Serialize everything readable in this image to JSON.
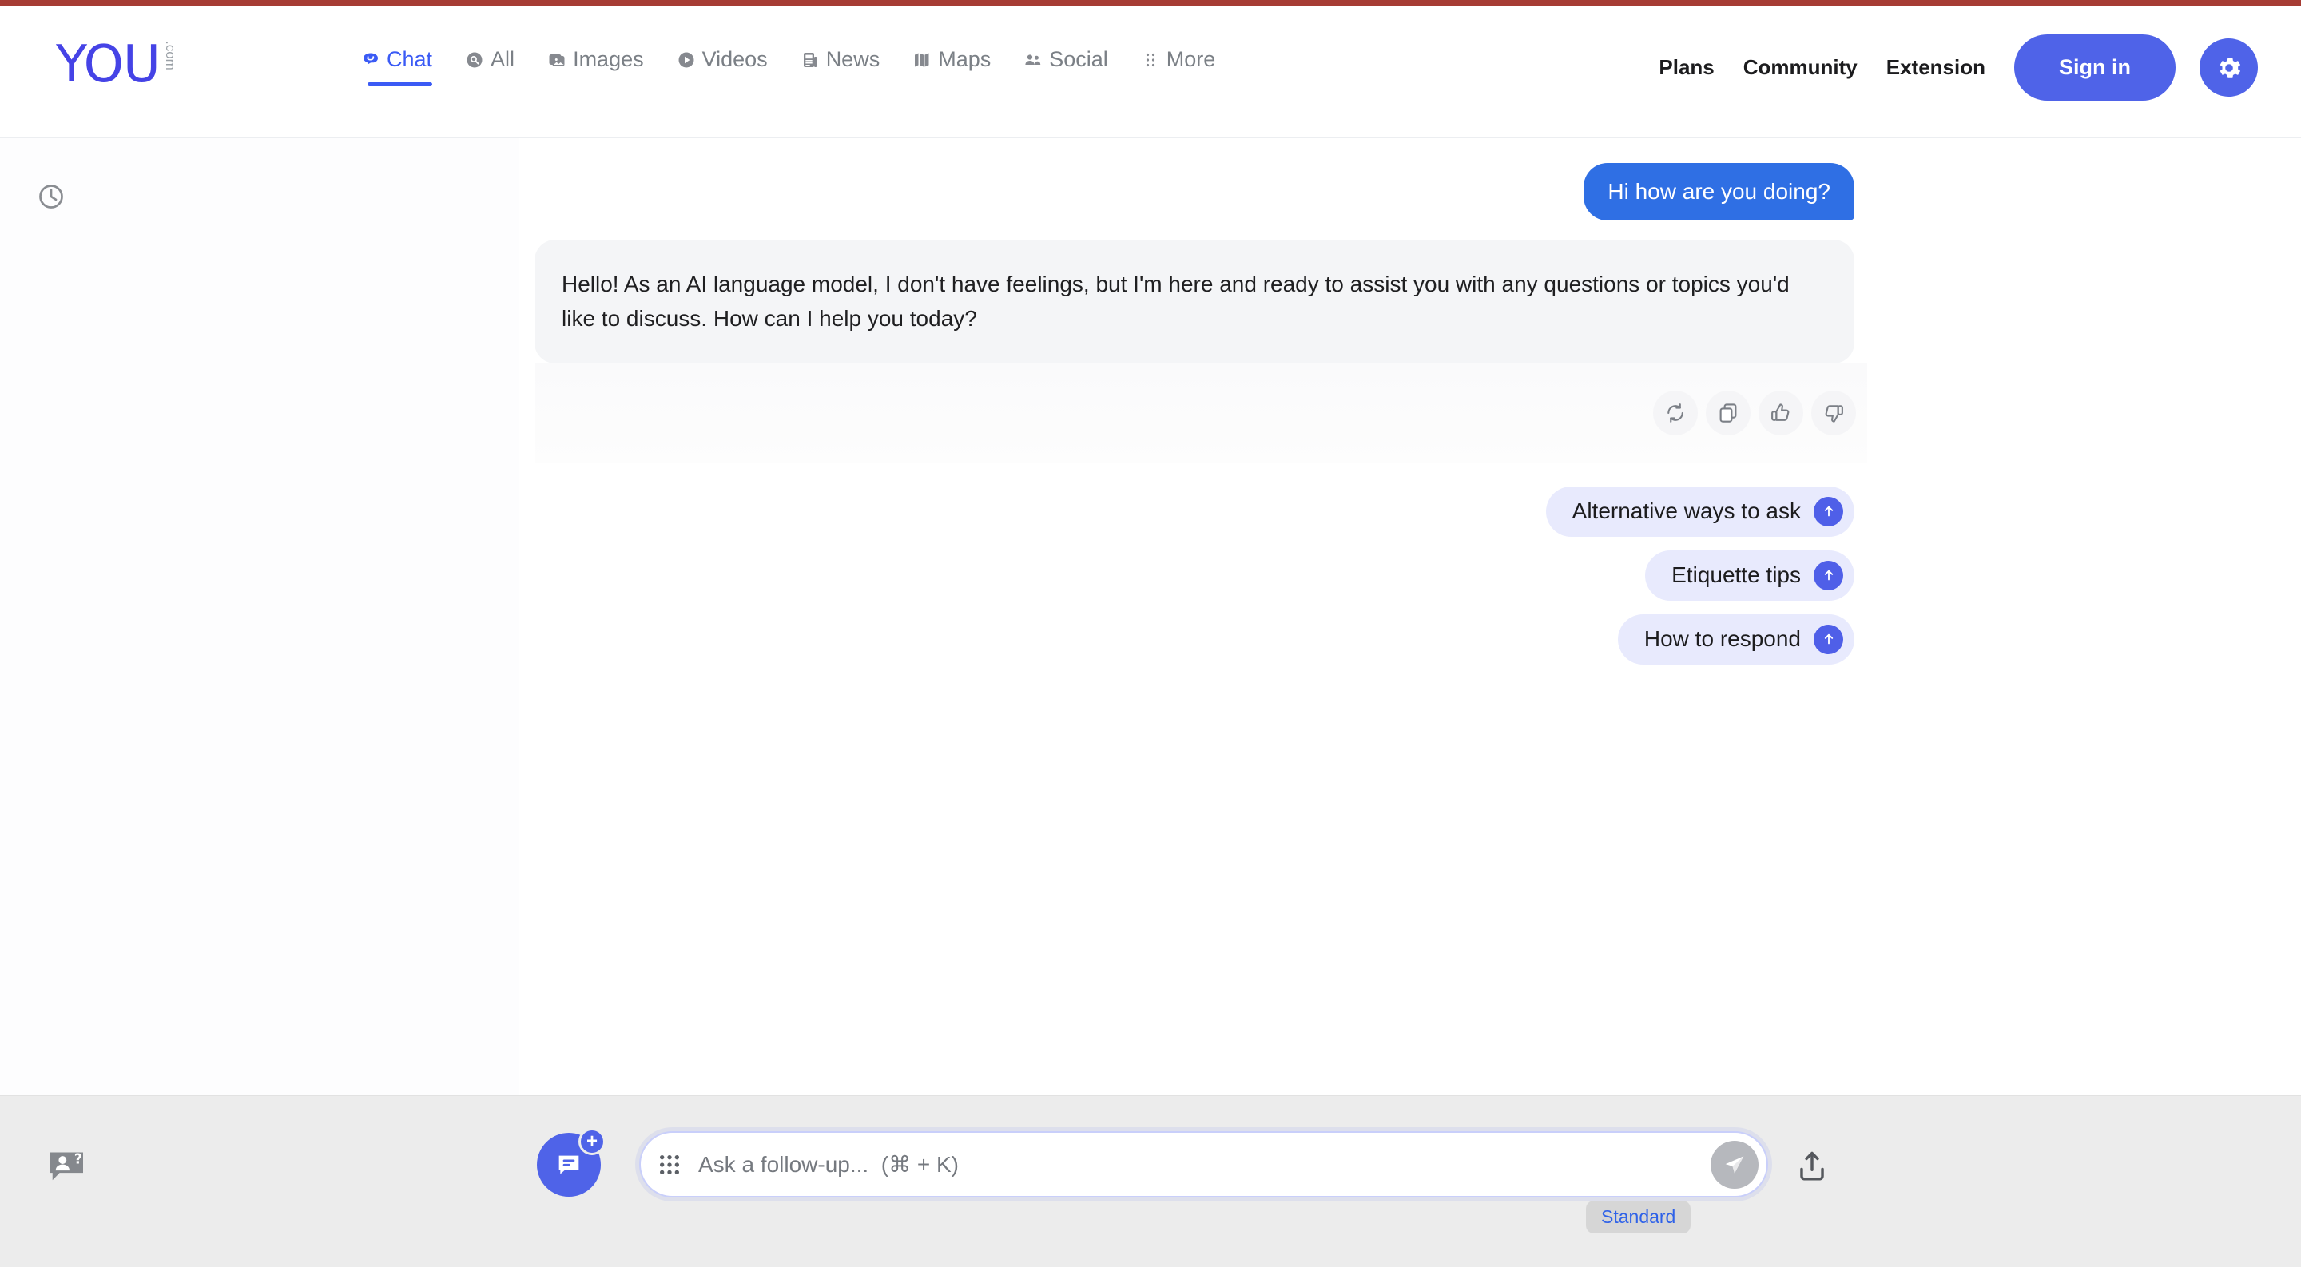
{
  "brand": {
    "logo_text": "YOU",
    "logo_suffix": ".com",
    "accent_color": "#4543e6",
    "primary_color": "#4f63e8",
    "user_bubble_color": "#2f6fe4",
    "top_strip_color": "#a63c34"
  },
  "nav": {
    "items": [
      {
        "label": "Chat",
        "icon": "chat-smiley-icon",
        "active": true
      },
      {
        "label": "All",
        "icon": "search-circle-icon",
        "active": false
      },
      {
        "label": "Images",
        "icon": "images-icon",
        "active": false
      },
      {
        "label": "Videos",
        "icon": "play-circle-icon",
        "active": false
      },
      {
        "label": "News",
        "icon": "news-icon",
        "active": false
      },
      {
        "label": "Maps",
        "icon": "maps-icon",
        "active": false
      },
      {
        "label": "Social",
        "icon": "social-people-icon",
        "active": false
      },
      {
        "label": "More",
        "icon": "more-dots-icon",
        "active": false
      }
    ]
  },
  "header_right": {
    "links": [
      "Plans",
      "Community",
      "Extension"
    ],
    "signin_label": "Sign in",
    "gear_icon": "gear-icon"
  },
  "sidebar": {
    "history_icon": "clock-history-icon"
  },
  "conversation": {
    "messages": [
      {
        "role": "user",
        "text": "Hi how are you doing?"
      },
      {
        "role": "assistant",
        "text": "Hello! As an AI language model, I don't have feelings, but I'm here and ready to assist you with any questions or topics you'd like to discuss. How can I help you today?"
      }
    ],
    "actions": [
      {
        "name": "regenerate-icon",
        "title": "Regenerate"
      },
      {
        "name": "copy-icon",
        "title": "Copy"
      },
      {
        "name": "thumbs-up-icon",
        "title": "Good response"
      },
      {
        "name": "thumbs-down-icon",
        "title": "Bad response"
      }
    ],
    "suggestions": [
      "Alternative ways to ask",
      "Etiquette tips",
      "How to respond"
    ]
  },
  "composer": {
    "placeholder": "Ask a follow-up...  (⌘ + K)",
    "value": "",
    "grid_icon": "apps-grid-icon",
    "send_icon": "send-paper-plane-icon",
    "upload_icon": "upload-icon",
    "new_chat_icon": "new-chat-icon",
    "feedback_icon": "feedback-person-icon",
    "mode_badge": "Standard"
  }
}
